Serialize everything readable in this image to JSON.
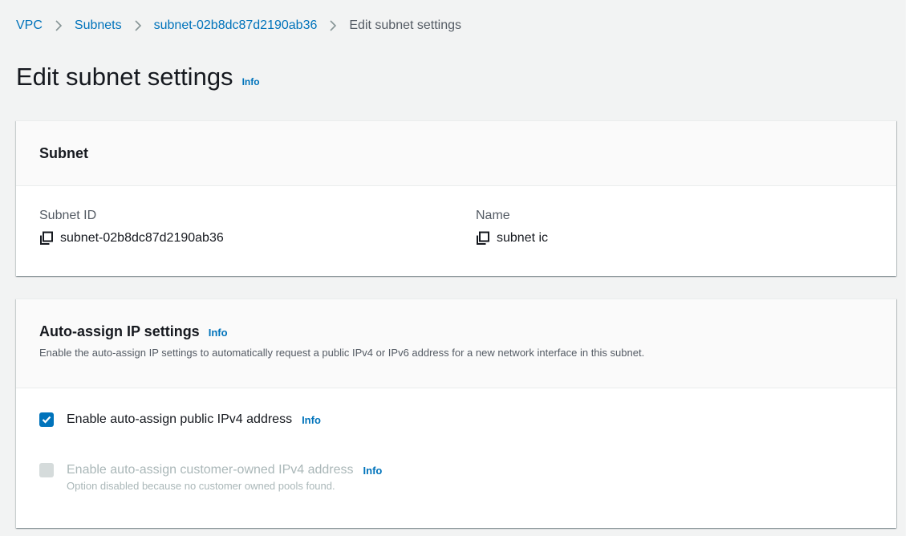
{
  "breadcrumb": {
    "items": [
      {
        "label": "VPC"
      },
      {
        "label": "Subnets"
      },
      {
        "label": "subnet-02b8dc87d2190ab36"
      }
    ],
    "current": "Edit subnet settings"
  },
  "page": {
    "title": "Edit subnet settings",
    "info": "Info"
  },
  "subnet_panel": {
    "heading": "Subnet",
    "subnet_id_label": "Subnet ID",
    "subnet_id_value": "subnet-02b8dc87d2190ab36",
    "name_label": "Name",
    "name_value": "subnet ic",
    "copy_icon": "copy-icon"
  },
  "auto_assign_panel": {
    "heading": "Auto-assign IP settings",
    "info": "Info",
    "description": "Enable the auto-assign IP settings to automatically request a public IPv4 or IPv6 address for a new network interface in this subnet.",
    "options": [
      {
        "label": "Enable auto-assign public IPv4 address",
        "info": "Info",
        "checked": true,
        "disabled": false
      },
      {
        "label": "Enable auto-assign customer-owned IPv4 address",
        "info": "Info",
        "checked": false,
        "disabled": true,
        "note": "Option disabled because no customer owned pools found."
      }
    ]
  },
  "colors": {
    "link": "#0073bb",
    "background": "#f2f3f3",
    "checkbox_checked": "#0073bb",
    "checkbox_disabled": "#d5dbdb",
    "disabled_text": "#aab7b8"
  }
}
